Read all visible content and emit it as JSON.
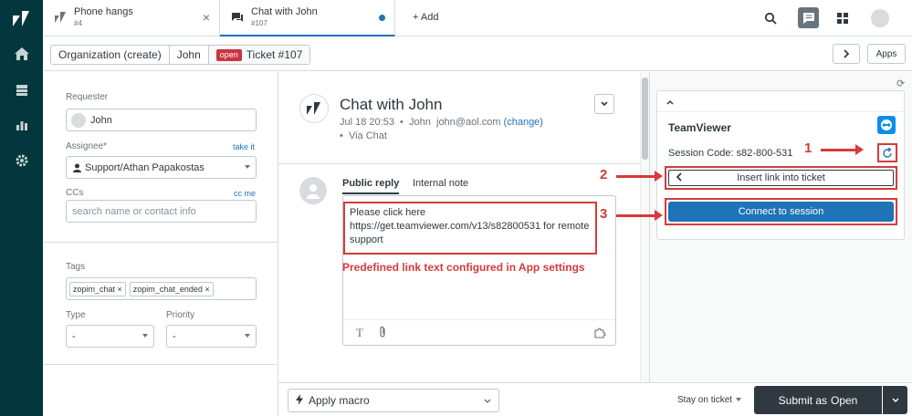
{
  "tabs": [
    {
      "title": "Phone hangs",
      "sub": "#4"
    },
    {
      "title": "Chat with John",
      "sub": "#107"
    }
  ],
  "add_tab_label": "+ Add",
  "breadcrumb": {
    "org": "Organization (create)",
    "user": "John",
    "status": "open",
    "ticket": "Ticket #107"
  },
  "apps_label": "Apps",
  "properties": {
    "requester_label": "Requester",
    "requester_value": "John",
    "assignee_label": "Assignee*",
    "take_it": "take it",
    "assignee_value": "Support/Athan Papakostas",
    "ccs_label": "CCs",
    "cc_me": "cc me",
    "ccs_placeholder": "search name or contact info",
    "tags_label": "Tags",
    "tags": [
      "zopim_chat",
      "zopim_chat_ended"
    ],
    "type_label": "Type",
    "type_value": "-",
    "priority_label": "Priority",
    "priority_value": "-"
  },
  "ticket": {
    "title": "Chat with John",
    "date": "Jul 18 20:53",
    "author": "John",
    "email": "john@aol.com",
    "change": "(change)",
    "via": "Via Chat"
  },
  "reply": {
    "tab_public": "Public reply",
    "tab_internal": "Internal note",
    "text": "Please click here https://get.teamviewer.com/v13/s82800531 for remote support",
    "annotation": "Predefined link text configured in App settings"
  },
  "app": {
    "name": "TeamViewer",
    "session_label": "Session Code:",
    "session_code": "s82-800-531",
    "insert_label": "Insert link into ticket",
    "connect_label": "Connect to session",
    "steps": [
      "1",
      "2",
      "3"
    ]
  },
  "bottom": {
    "macro": "Apply macro",
    "stay": "Stay on ticket",
    "submit_prefix": "Submit as",
    "submit_status": "Open"
  },
  "colors": {
    "nav": "#03363d",
    "accent": "#1f73b7",
    "annotation": "#d63a3a",
    "submit": "#2f3941"
  }
}
